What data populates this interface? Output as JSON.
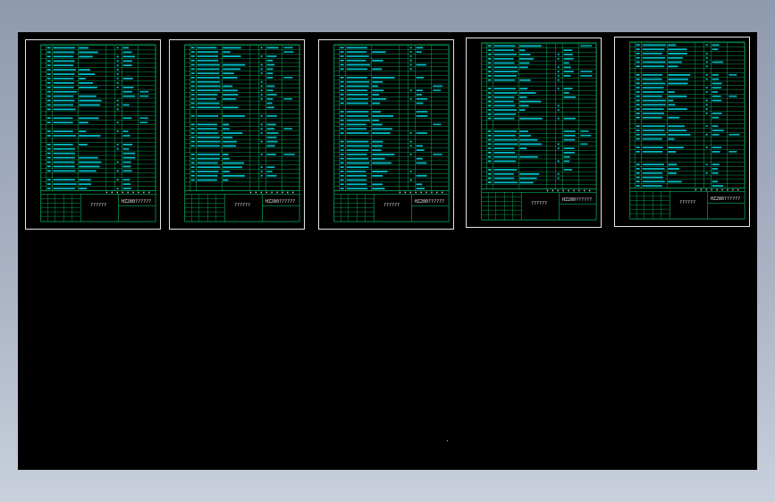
{
  "app": {
    "viewport_label": "cad-model-space",
    "colors": {
      "frame_background": "#9aa4b6",
      "canvas": "#000000",
      "sheet_border": "#e6e6e6",
      "table_lines": "#00e07a",
      "bom_text": "#00d8e8",
      "title_text": "#eaeaea"
    }
  },
  "sheets": [
    {
      "title_text": "??????",
      "drawing_no": "HZ280??????",
      "rows": 33
    },
    {
      "title_text": "??????",
      "drawing_no": "HZ280??????",
      "rows": 34
    },
    {
      "title_text": "??????",
      "drawing_no": "HZ280??????",
      "rows": 34
    },
    {
      "title_text": "??????",
      "drawing_no": "HZ280??????",
      "rows": 34
    },
    {
      "title_text": "??????",
      "drawing_no": "HZ280??????",
      "rows": 34
    }
  ]
}
